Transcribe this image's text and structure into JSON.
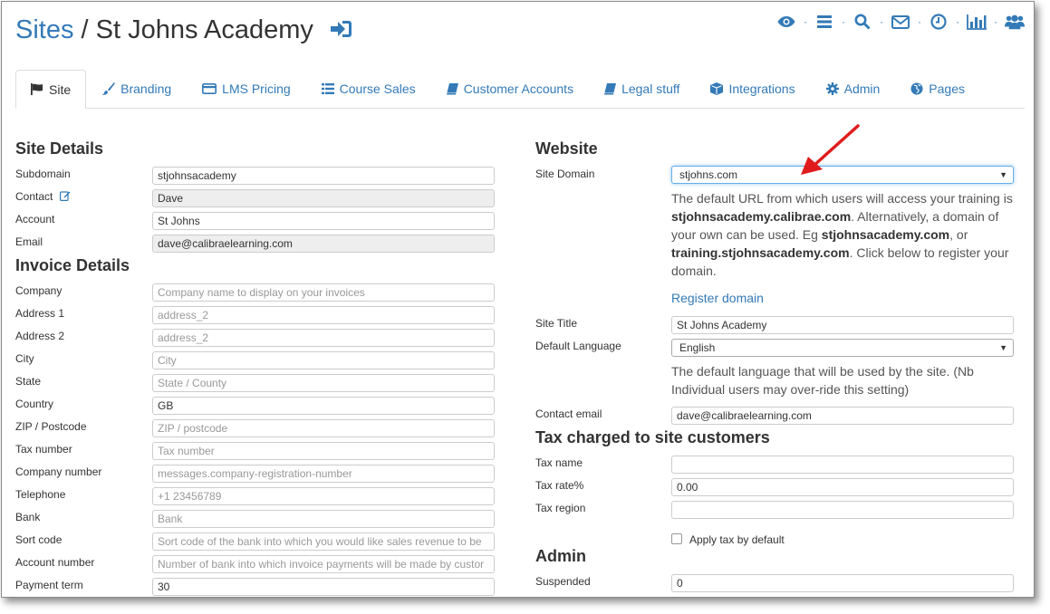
{
  "header": {
    "breadcrumb_root": "Sites",
    "breadcrumb_sep": "/",
    "breadcrumb_current": "St Johns Academy"
  },
  "toolbar": {
    "icons": [
      "eye-icon",
      "list-icon",
      "search-icon",
      "envelope-icon",
      "clock-icon",
      "bar-chart-icon",
      "users-icon"
    ],
    "separator": "·"
  },
  "tabs": [
    {
      "label": "Site",
      "icon": "flag-icon"
    },
    {
      "label": "Branding",
      "icon": "brush-icon"
    },
    {
      "label": "LMS Pricing",
      "icon": "credit-card-icon"
    },
    {
      "label": "Course Sales",
      "icon": "list-icon"
    },
    {
      "label": "Customer Accounts",
      "icon": "book-icon"
    },
    {
      "label": "Legal stuff",
      "icon": "book-icon"
    },
    {
      "label": "Integrations",
      "icon": "cube-icon"
    },
    {
      "label": "Admin",
      "icon": "gear-icon"
    },
    {
      "label": "Pages",
      "icon": "globe-icon"
    }
  ],
  "site_details": {
    "heading": "Site Details",
    "subdomain": {
      "label": "Subdomain",
      "value": "stjohnsacademy"
    },
    "contact": {
      "label": "Contact",
      "value": "Dave"
    },
    "account": {
      "label": "Account",
      "value": "St Johns"
    },
    "email": {
      "label": "Email",
      "value": "dave@calibraelearning.com"
    }
  },
  "invoice_details": {
    "heading": "Invoice Details",
    "company": {
      "label": "Company",
      "value": "",
      "placeholder": "Company name to display on your invoices"
    },
    "address1": {
      "label": "Address 1",
      "value": "",
      "placeholder": "address_2"
    },
    "address2": {
      "label": "Address 2",
      "value": "",
      "placeholder": "address_2"
    },
    "city": {
      "label": "City",
      "value": "",
      "placeholder": "City"
    },
    "state": {
      "label": "State",
      "value": "",
      "placeholder": "State / County"
    },
    "country": {
      "label": "Country",
      "value": "GB",
      "placeholder": ""
    },
    "zip": {
      "label": "ZIP / Postcode",
      "value": "",
      "placeholder": "ZIP / postcode"
    },
    "tax_number": {
      "label": "Tax number",
      "value": "",
      "placeholder": "Tax number"
    },
    "company_number": {
      "label": "Company number",
      "value": "",
      "placeholder": "messages.company-registration-number"
    },
    "telephone": {
      "label": "Telephone",
      "value": "",
      "placeholder": "+1 23456789"
    },
    "bank": {
      "label": "Bank",
      "value": "",
      "placeholder": "Bank"
    },
    "sort_code": {
      "label": "Sort code",
      "value": "",
      "placeholder": "Sort code of the bank into which you would like sales revenue to be"
    },
    "account_number": {
      "label": "Account number",
      "value": "",
      "placeholder": "Number of bank into which invoice payments will be made by custor"
    },
    "payment_term": {
      "label": "Payment term",
      "value": "30",
      "placeholder": ""
    }
  },
  "website": {
    "heading": "Website",
    "site_domain": {
      "label": "Site Domain",
      "value": "stjohns.com"
    },
    "domain_help": {
      "p1": "The default URL from which users will access your training is ",
      "b1": "stjohnsacademy.calibrae.com",
      "p2": ". Alternatively, a domain of your own can be used. Eg ",
      "b2": "stjohnsacademy.com",
      "p3": ", or ",
      "b3": "training.stjohnsacademy.com",
      "p4": ". Click below to register your domain."
    },
    "register_link": "Register domain",
    "site_title": {
      "label": "Site Title",
      "value": "St Johns Academy"
    },
    "default_language": {
      "label": "Default Language",
      "value": "English"
    },
    "language_help": "The default language that will be used by the site. (Nb Individual users may over-ride this setting)",
    "contact_email": {
      "label": "Contact email",
      "value": "dave@calibraelearning.com"
    }
  },
  "tax": {
    "heading": "Tax charged to site customers",
    "tax_name": {
      "label": "Tax name",
      "value": ""
    },
    "tax_rate": {
      "label": "Tax rate%",
      "value": "0.00"
    },
    "tax_region": {
      "label": "Tax region",
      "value": ""
    },
    "apply_tax": {
      "label": "Apply tax by default",
      "checked": false
    }
  },
  "admin": {
    "heading": "Admin",
    "suspended": {
      "label": "Suspended",
      "value": "0"
    }
  },
  "colors": {
    "link": "#337ab7",
    "annotation_arrow": "#e01b1b"
  }
}
